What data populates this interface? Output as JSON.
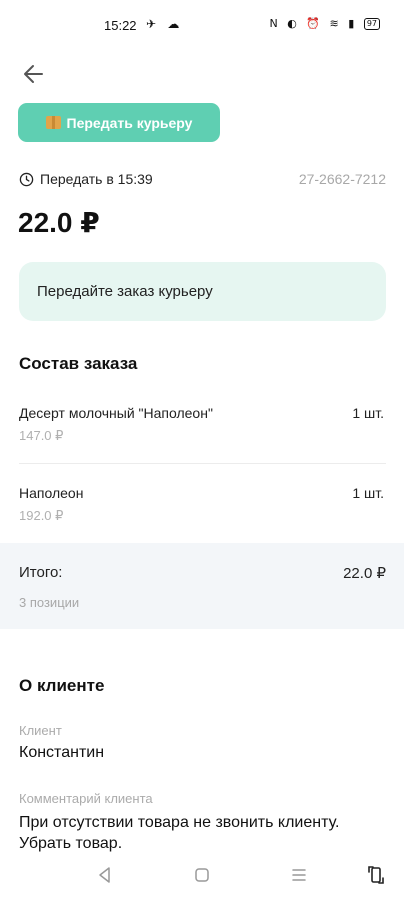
{
  "status_bar": {
    "time": "15:22",
    "battery": "97"
  },
  "actions": {
    "courier_button_label": "Передать курьеру"
  },
  "order": {
    "deadline": "Передать в 15:39",
    "order_id": "27-2662-7212",
    "total": "22.0 ₽",
    "hint": "Передайте заказ курьеру"
  },
  "composition": {
    "title": "Состав заказа",
    "items": [
      {
        "name": "Десерт молочный \"Наполеон\"",
        "price": "147.0 ₽",
        "qty": "1 шт."
      },
      {
        "name": "Наполеон",
        "price": "192.0 ₽",
        "qty": "1 шт."
      }
    ],
    "total_label": "Итого:",
    "total_value": "22.0 ₽",
    "positions": "3 позиции"
  },
  "client": {
    "title": "О клиенте",
    "name_label": "Клиент",
    "name": "Константин",
    "comment_label": "Комментарий клиента",
    "comment": "При отсутствии товара не звонить клиенту. Убрать товар."
  },
  "colors": {
    "accent": "#5fcfb2",
    "hint_bg": "#e6f6f1",
    "total_bg": "#f3f6f9"
  },
  "icons": [
    "back-arrow-icon",
    "box-icon",
    "clock-icon",
    "nav-back-icon",
    "nav-home-icon",
    "nav-menu-icon",
    "nav-rotate-icon"
  ]
}
